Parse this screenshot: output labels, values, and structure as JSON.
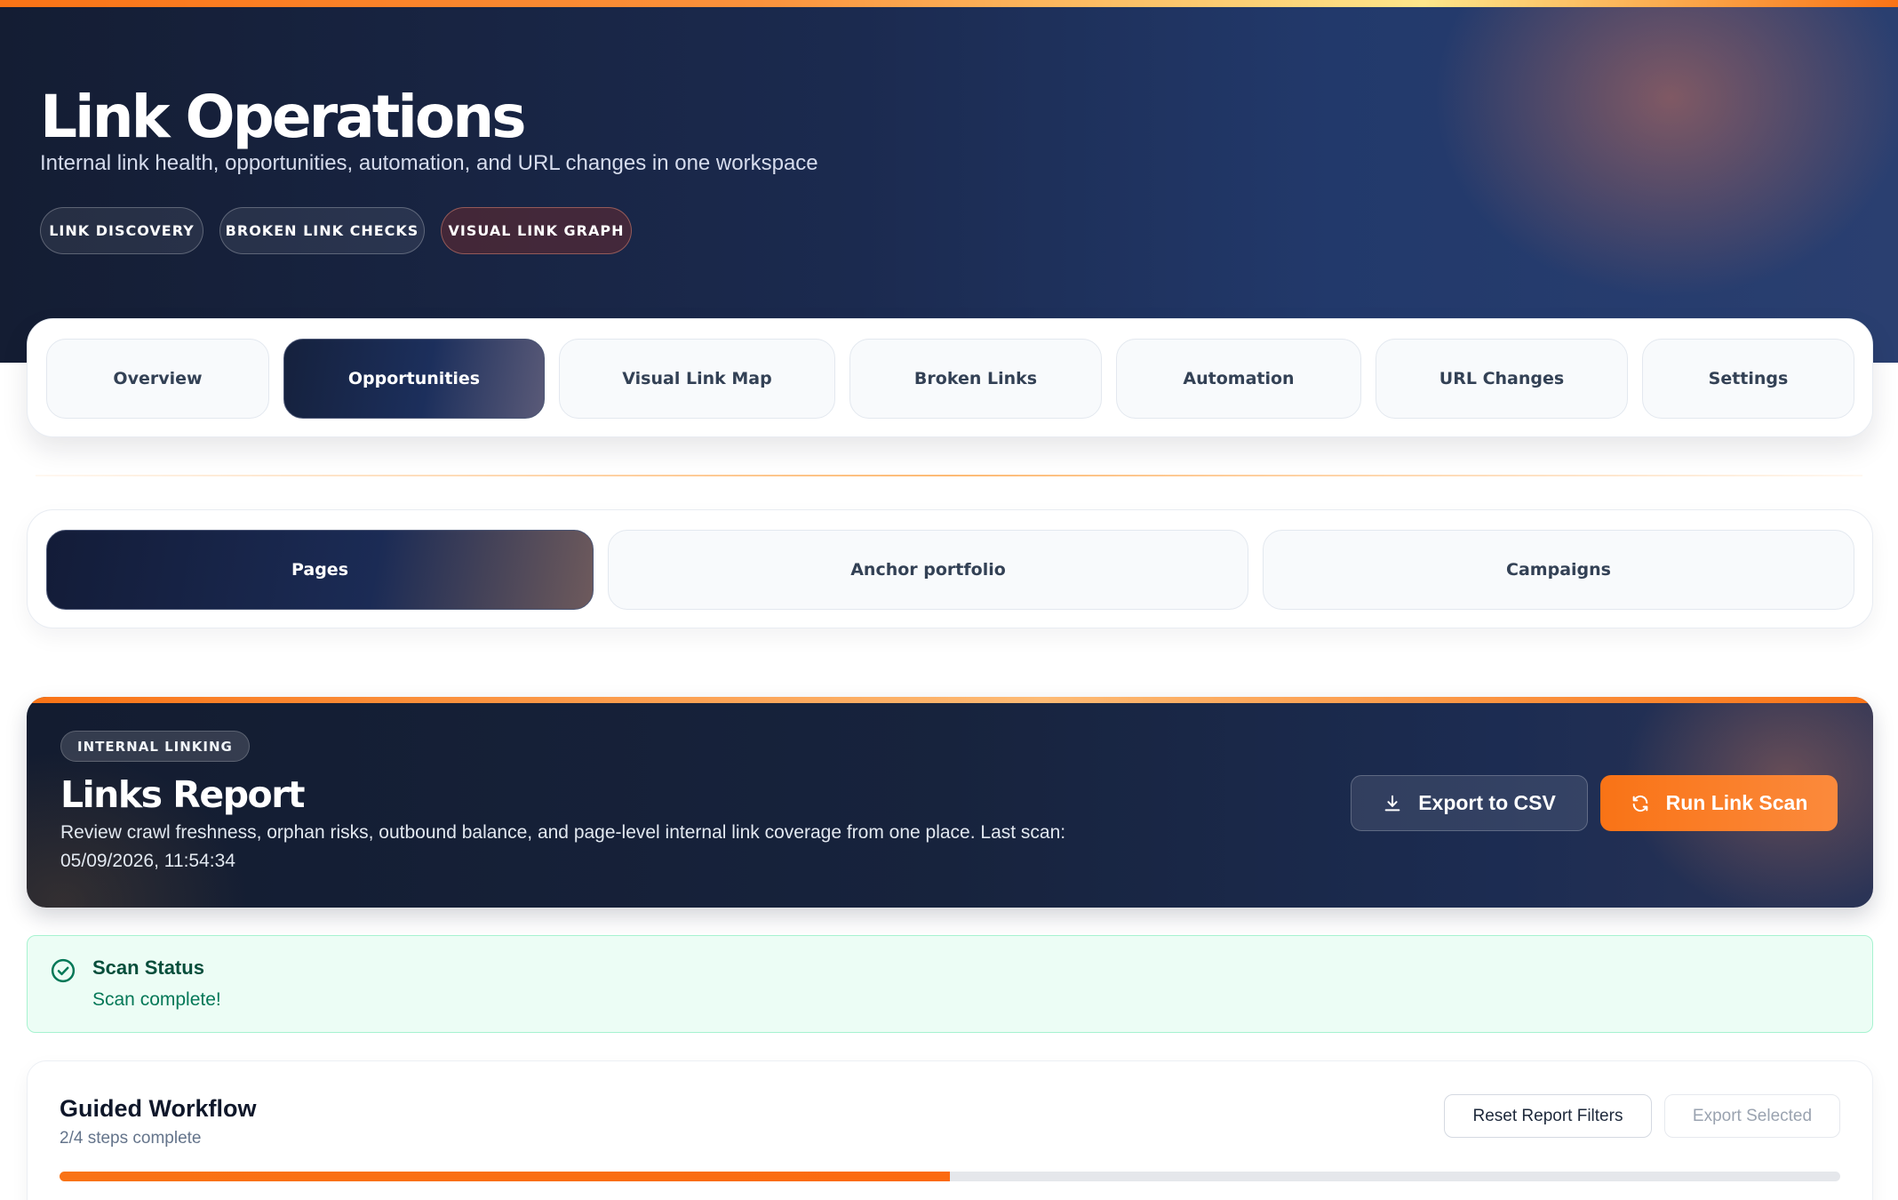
{
  "header": {
    "title": "Link Operations",
    "subtitle": "Internal link health, opportunities, automation, and URL changes in one workspace",
    "pills": [
      "LINK DISCOVERY",
      "BROKEN LINK CHECKS",
      "VISUAL LINK GRAPH"
    ]
  },
  "main_tabs": [
    {
      "label": "Overview",
      "active": false
    },
    {
      "label": "Opportunities",
      "active": true
    },
    {
      "label": "Visual Link Map",
      "active": false
    },
    {
      "label": "Broken Links",
      "active": false
    },
    {
      "label": "Automation",
      "active": false
    },
    {
      "label": "URL Changes",
      "active": false
    },
    {
      "label": "Settings",
      "active": false
    }
  ],
  "sub_tabs": [
    {
      "label": "Pages",
      "active": true
    },
    {
      "label": "Anchor portfolio",
      "active": false
    },
    {
      "label": "Campaigns",
      "active": false
    }
  ],
  "report": {
    "badge": "INTERNAL LINKING",
    "title": "Links Report",
    "description": "Review crawl freshness, orphan risks, outbound balance, and page-level internal link coverage from one place. Last scan: 05/09/2026, 11:54:34",
    "export_label": "Export to CSV",
    "run_label": "Run Link Scan",
    "export_icon": "download-icon",
    "run_icon": "refresh-icon"
  },
  "scan_status": {
    "title": "Scan Status",
    "message": "Scan complete!",
    "icon": "check-circle-icon"
  },
  "workflow": {
    "title": "Guided Workflow",
    "steps_text": "2/4 steps complete",
    "steps_done": 2,
    "steps_total": 4,
    "reset_label": "Reset Report Filters",
    "export_selected_label": "Export Selected"
  },
  "colors": {
    "accent": "#f97316",
    "navy": "#15213d",
    "success_bg": "#ecfdf5",
    "success_text": "#047857"
  }
}
